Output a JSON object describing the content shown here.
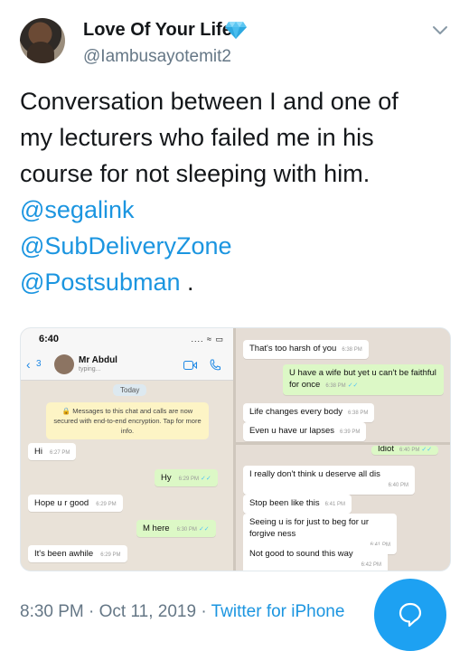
{
  "tweet": {
    "display_name": "Love Of Your Life",
    "handle": "@Iambusayotemit2",
    "text_lines": [
      "Conversation between I and one of",
      "my lecturers who failed me in his",
      "course for not sleeping with him."
    ],
    "mentions": [
      "@segalink",
      "@SubDeliveryZone",
      "@Postsubman"
    ],
    "mention_suffix": " .",
    "time": "8:30 PM",
    "separator": "·",
    "date": "Oct 11, 2019",
    "source": "Twitter for iPhone"
  },
  "colors": {
    "link": "#1b95e0",
    "fab": "#1da1f2",
    "muted": "#657786",
    "out_bubble": "#dcf8c6"
  },
  "icons": {
    "verified_gem": "gem-icon",
    "menu": "chevron-down-icon",
    "compose_reply": "reply-bubble-icon"
  },
  "screenshot_left": {
    "status_time": "6:40",
    "status_icons": ".... ≈ ▭",
    "back_label": "3",
    "contact_name": "Mr Abdul",
    "contact_status": "typing...",
    "date_pill": "Today",
    "notice": "🔒 Messages to this chat and calls are now secured with end-to-end encryption. Tap for more info.",
    "messages": [
      {
        "text": "Hi",
        "time": "6:27 PM",
        "dir": "in"
      },
      {
        "text": "Hy",
        "time": "6:29 PM",
        "dir": "out"
      },
      {
        "text": "Hope u r good",
        "time": "6:29 PM",
        "dir": "in"
      },
      {
        "text": "M here",
        "time": "6:30 PM",
        "dir": "out"
      },
      {
        "text": "It's been awhile",
        "time": "6:29 PM",
        "dir": "in"
      }
    ]
  },
  "screenshot_right": {
    "messages_top": [
      {
        "text": "That's too harsh of you",
        "time": "6:38 PM",
        "dir": "in"
      },
      {
        "text": "U have a wife but yet u can't be faithful for once",
        "time": "6:38 PM",
        "dir": "out"
      },
      {
        "text": "Life changes every body",
        "time": "6:38 PM",
        "dir": "in"
      },
      {
        "text": "Even u have ur lapses",
        "time": "6:39 PM",
        "dir": "in"
      }
    ],
    "messages_bottom": [
      {
        "text": "Idiot",
        "time": "6:40 PM",
        "dir": "out"
      },
      {
        "text": "I really don't think u deserve all dis",
        "time": "6:40 PM",
        "dir": "in"
      },
      {
        "text": "Stop been like this",
        "time": "6:41 PM",
        "dir": "in"
      },
      {
        "text": "Seeing u is for just to beg for ur forgive ness",
        "time": "6:41 PM",
        "dir": "in"
      },
      {
        "text": "Not good to sound this way",
        "time": "6:42 PM",
        "dir": "in"
      }
    ]
  }
}
